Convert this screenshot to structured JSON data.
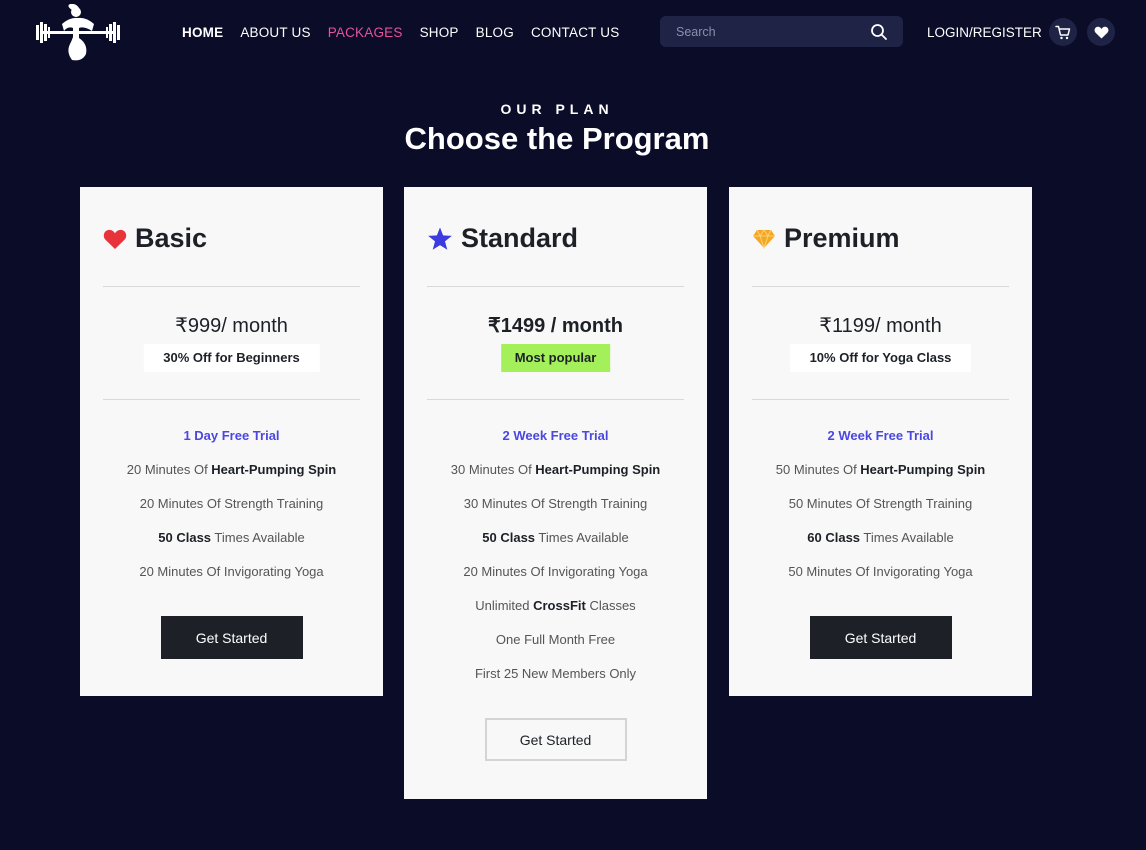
{
  "nav": {
    "items": [
      {
        "label": "HOME"
      },
      {
        "label": "ABOUT US"
      },
      {
        "label": "PACKAGES"
      },
      {
        "label": "SHOP"
      },
      {
        "label": "BLOG"
      },
      {
        "label": "CONTACT US"
      }
    ],
    "active": "PACKAGES",
    "search_placeholder": "Search",
    "login_label": "LOGIN/REGISTER"
  },
  "section": {
    "kicker": "OUR PLAN",
    "title": "Choose the Program"
  },
  "plans": [
    {
      "name": "Basic",
      "icon": "heart-icon",
      "currency": "₹",
      "price_text": "999/ month",
      "badge": "30% Off for Beginners",
      "trial": "1 Day Free Trial",
      "features": [
        {
          "pre": "20 Minutes Of ",
          "bold": "Heart-Pumping Spin",
          "post": ""
        },
        {
          "pre": "20 Minutes Of Strength Training",
          "bold": "",
          "post": ""
        },
        {
          "pre": "",
          "bold": "50 Class",
          "post": " Times Available"
        },
        {
          "pre": "20 Minutes Of Invigorating Yoga",
          "bold": "",
          "post": ""
        }
      ],
      "cta": "Get Started"
    },
    {
      "name": "Standard",
      "icon": "star-icon",
      "currency": "₹",
      "price_text": "1499 / month",
      "badge": "Most popular",
      "trial": "2 Week Free Trial",
      "features": [
        {
          "pre": "30 Minutes Of ",
          "bold": "Heart-Pumping Spin",
          "post": ""
        },
        {
          "pre": "30 Minutes Of Strength Training",
          "bold": "",
          "post": ""
        },
        {
          "pre": "",
          "bold": "50 Class",
          "post": " Times Available"
        },
        {
          "pre": "20 Minutes Of Invigorating Yoga",
          "bold": "",
          "post": ""
        },
        {
          "pre": "Unlimited ",
          "bold": "CrossFit",
          "post": " Classes"
        },
        {
          "pre": "One Full Month Free",
          "bold": "",
          "post": ""
        },
        {
          "pre": "First 25 New Members Only",
          "bold": "",
          "post": ""
        }
      ],
      "cta": "Get Started"
    },
    {
      "name": "Premium",
      "icon": "diamond-icon",
      "currency": "₹",
      "price_text": "1199/ month",
      "badge": "10% Off for Yoga Class",
      "trial": "2 Week Free Trial",
      "features": [
        {
          "pre": "50 Minutes Of ",
          "bold": "Heart-Pumping Spin",
          "post": ""
        },
        {
          "pre": "50 Minutes Of Strength Training",
          "bold": "",
          "post": ""
        },
        {
          "pre": "",
          "bold": "60 Class",
          "post": " Times Available"
        },
        {
          "pre": "50 Minutes Of Invigorating Yoga",
          "bold": "",
          "post": ""
        }
      ],
      "cta": "Get Started"
    }
  ],
  "colors": {
    "background": "#0a0c28",
    "nav_active": "#e8519b",
    "trial_text": "#4b47e0",
    "popular_badge": "#a3f05a",
    "heart": "#e8333b",
    "star": "#3b3be0",
    "diamond": "#f5a623"
  }
}
